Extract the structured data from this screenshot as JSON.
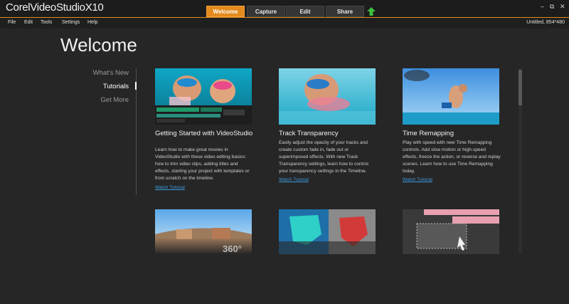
{
  "app": {
    "brand_prefix": "Corel",
    "brand_name": "VideoStudio",
    "brand_version": "X10"
  },
  "tabs": [
    {
      "label": "Welcome",
      "active": true
    },
    {
      "label": "Capture",
      "active": false
    },
    {
      "label": "Edit",
      "active": false
    },
    {
      "label": "Share",
      "active": false
    }
  ],
  "window_controls": [
    "–",
    "⧉",
    "✕"
  ],
  "menu": [
    "File",
    "Edit",
    "Tools",
    "Settings",
    "Help"
  ],
  "project_info": "Untitled, 854*480",
  "page_title": "Welcome",
  "nav": [
    {
      "label": "What's New",
      "active": false
    },
    {
      "label": "Tutorials",
      "active": true
    },
    {
      "label": "Get More",
      "active": false
    }
  ],
  "cards": [
    {
      "title": "Getting Started with VideoStudio",
      "description": "Learn how to make great movies in VideoStudio with these video editing basics: how to trim video clips, adding titles and effects, starting your project with templates or from scratch on the timeline.",
      "link": "Watch Tutorial"
    },
    {
      "title": "Track Transparency",
      "description": "Easily adjust the opacity of your tracks and create custom fade in, fade out or superimposed effects. With new Track Transparency settings, learn how to control your transparency settings in the Timeline.",
      "link": "Watch Tutorial"
    },
    {
      "title": "Time Remapping",
      "description": "Play with speed with new Time Remapping controls. Add slow motion or high-speed effects, freeze the action, or reverse and replay scenes. Learn how to use Time Remapping today.",
      "link": "Watch Tutorial"
    }
  ],
  "thumb_badge": "360°",
  "colors": {
    "accent": "#e38a1c",
    "link": "#3b9be0",
    "background": "#262626"
  }
}
